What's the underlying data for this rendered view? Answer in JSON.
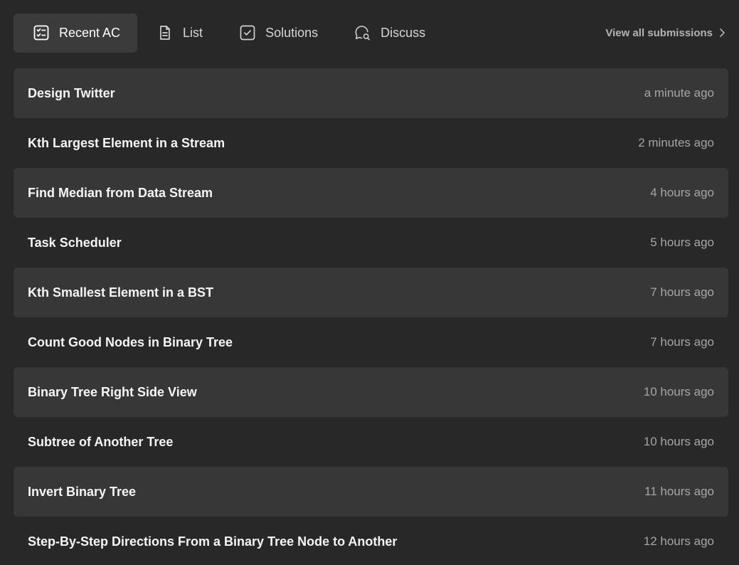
{
  "tabs": [
    {
      "label": "Recent AC",
      "icon": "checklist-icon",
      "active": true
    },
    {
      "label": "List",
      "icon": "document-icon",
      "active": false
    },
    {
      "label": "Solutions",
      "icon": "checkbox-icon",
      "active": false
    },
    {
      "label": "Discuss",
      "icon": "chat-search-icon",
      "active": false
    }
  ],
  "view_all": {
    "label": "View all submissions",
    "icon": "chevron-right-icon"
  },
  "submissions": [
    {
      "title": "Design Twitter",
      "time": "a minute ago"
    },
    {
      "title": "Kth Largest Element in a Stream",
      "time": "2 minutes ago"
    },
    {
      "title": "Find Median from Data Stream",
      "time": "4 hours ago"
    },
    {
      "title": "Task Scheduler",
      "time": "5 hours ago"
    },
    {
      "title": "Kth Smallest Element in a BST",
      "time": "7 hours ago"
    },
    {
      "title": "Count Good Nodes in Binary Tree",
      "time": "7 hours ago"
    },
    {
      "title": "Binary Tree Right Side View",
      "time": "10 hours ago"
    },
    {
      "title": "Subtree of Another Tree",
      "time": "10 hours ago"
    },
    {
      "title": "Invert Binary Tree",
      "time": "11 hours ago"
    },
    {
      "title": "Step-By-Step Directions From a Binary Tree Node to Another",
      "time": "12 hours ago"
    }
  ],
  "colors": {
    "background": "#282828",
    "row_alt": "#373737",
    "active_tab": "#3b3b3b",
    "text": "#f5f5f5",
    "muted": "#a6a6a6"
  }
}
